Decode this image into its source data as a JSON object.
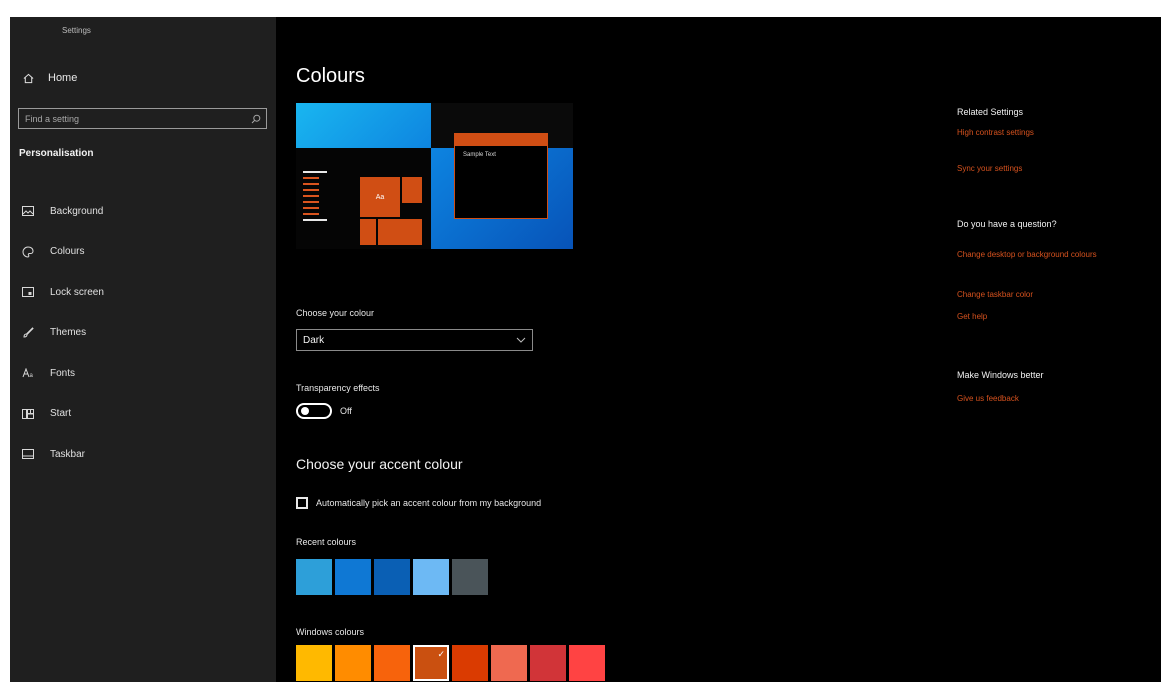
{
  "app": {
    "title": "Settings"
  },
  "sidebar": {
    "home": {
      "label": "Home",
      "icon": "home-icon"
    },
    "search": {
      "placeholder": "Find a setting",
      "icon": "search-icon"
    },
    "section_title": "Personalisation",
    "items": [
      {
        "label": "Background",
        "icon": "picture-icon"
      },
      {
        "label": "Colours",
        "icon": "palette-icon"
      },
      {
        "label": "Lock screen",
        "icon": "lock-screen-icon"
      },
      {
        "label": "Themes",
        "icon": "brush-icon"
      },
      {
        "label": "Fonts",
        "icon": "font-icon"
      },
      {
        "label": "Start",
        "icon": "start-icon"
      },
      {
        "label": "Taskbar",
        "icon": "taskbar-icon"
      }
    ]
  },
  "main": {
    "title": "Colours",
    "preview": {
      "sample_text": "Sample Text",
      "tile_text": "Aa"
    },
    "choose_colour": {
      "label": "Choose your colour",
      "value": "Dark"
    },
    "transparency": {
      "label": "Transparency effects",
      "state": "Off"
    },
    "accent": {
      "heading": "Choose your accent colour",
      "auto_pick_label": "Automatically pick an accent colour from my background",
      "auto_pick_checked": false,
      "recent_label": "Recent colours",
      "recent_colours": [
        "#2d9fd9",
        "#0f78d4",
        "#0a5fb4",
        "#6db9f4",
        "#4a5459"
      ],
      "windows_label": "Windows colours",
      "windows_colours": [
        "#ffb900",
        "#ff8c00",
        "#f7630c",
        "#ca5010",
        "#da3b01",
        "#ef6950",
        "#d13438",
        "#ff4343"
      ],
      "selected_windows_colour_index": 3
    }
  },
  "related": {
    "related_heading": "Related Settings",
    "related_links": [
      "High contrast settings",
      "Sync your settings"
    ],
    "question_heading": "Do you have a question?",
    "question_links": [
      "Change desktop or background colours",
      "Change taskbar color",
      "Get help"
    ],
    "feedback_heading": "Make Windows better",
    "feedback_link": "Give us feedback"
  },
  "colors": {
    "accent": "#d6521e",
    "background": "#000000",
    "sidebar": "#1f1f1f"
  }
}
